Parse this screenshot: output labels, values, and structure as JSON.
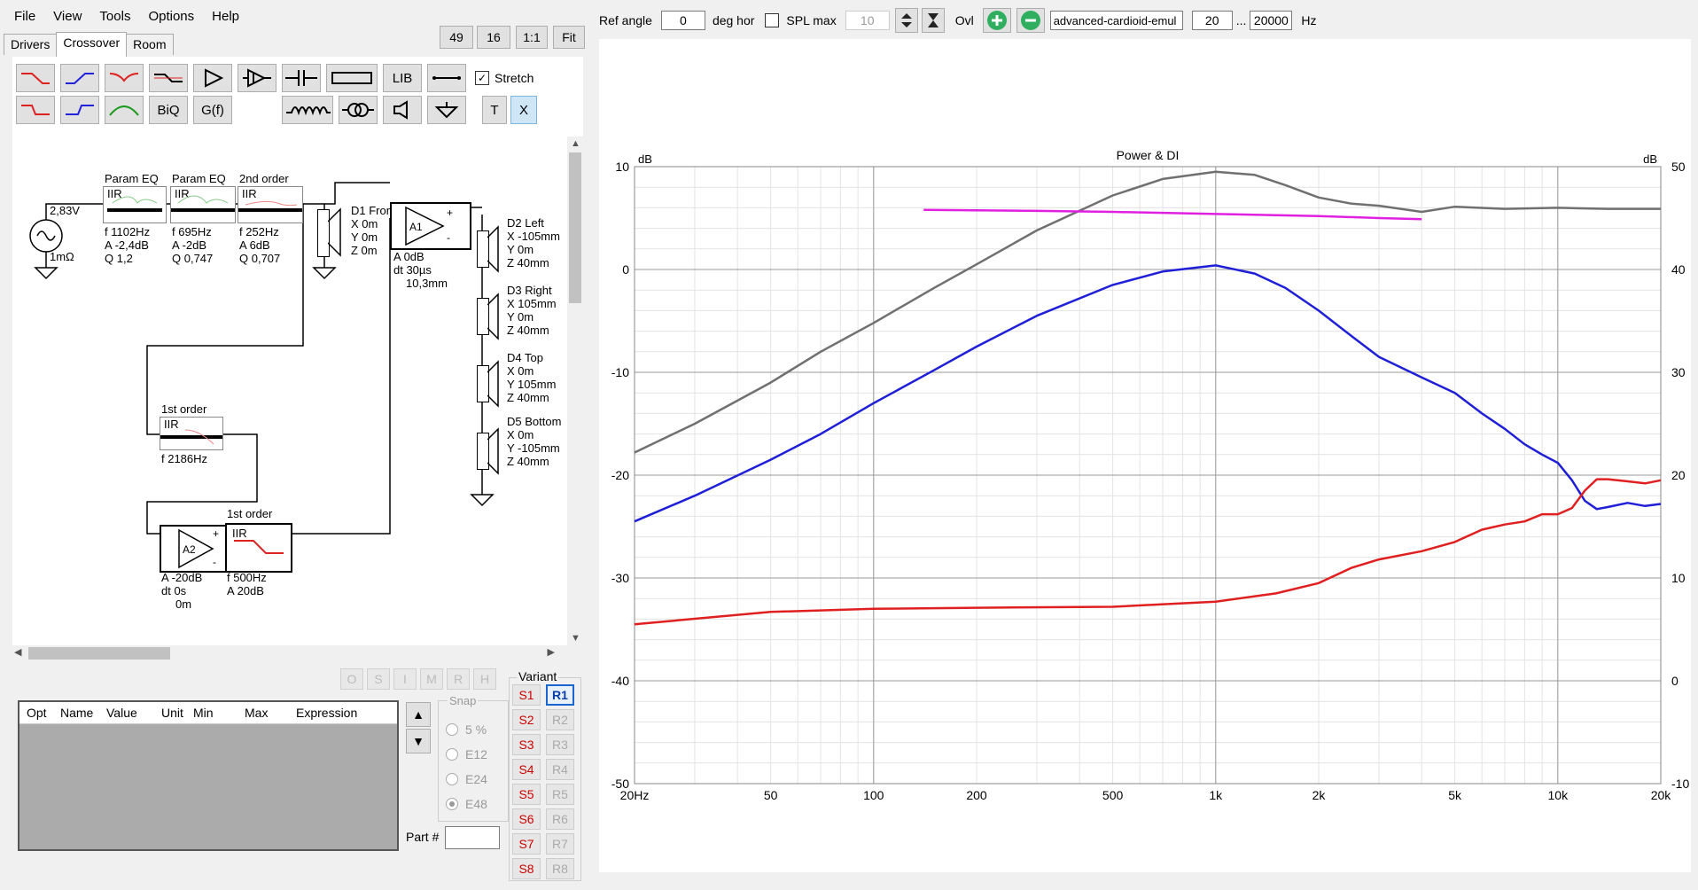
{
  "menu": [
    "File",
    "View",
    "Tools",
    "Options",
    "Help"
  ],
  "tabs": [
    "Drivers",
    "Crossover",
    "Room"
  ],
  "view_buttons": [
    "49",
    "16",
    "1:1",
    "Fit"
  ],
  "toolbar": {
    "lib": "LIB",
    "biq": "BiQ",
    "gf": "G(f)",
    "t": "T",
    "x": "X",
    "stretch": "Stretch"
  },
  "schematic": {
    "source_voltage": "2,83V",
    "source_impedance": "1mΩ",
    "eq1": {
      "title": "Param EQ",
      "type": "IIR",
      "f": "f   1102Hz",
      "a": "A  -2,4dB",
      "q": "Q  1,2"
    },
    "eq2": {
      "title": "Param EQ",
      "type": "IIR",
      "f": "f   695Hz",
      "a": "A  -2dB",
      "q": "Q  0,747"
    },
    "eq3": {
      "title": "2nd order",
      "type": "IIR",
      "f": "f   252Hz",
      "a": "A  6dB",
      "q": "Q  0,707"
    },
    "d1": {
      "name": "D1 Front",
      "x": "X 0m",
      "y": "Y 0m",
      "z": "Z 0m"
    },
    "a1": {
      "name": "A1",
      "gain": "A  0dB",
      "dt": "dt 30µs",
      "dist": "10,3mm"
    },
    "d2": {
      "name": "D2 Left",
      "x": "X -105mm",
      "y": "Y 0m",
      "z": "Z 40mm"
    },
    "d3": {
      "name": "D3 Right",
      "x": "X 105mm",
      "y": "Y 0m",
      "z": "Z 40mm"
    },
    "d4": {
      "name": "D4 Top",
      "x": "X 0m",
      "y": "Y 105mm",
      "z": "Z 40mm"
    },
    "d5": {
      "name": "D5 Bottom",
      "x": "X 0m",
      "y": "Y -105mm",
      "z": "Z 40mm"
    },
    "f1": {
      "title": "1st order",
      "type": "IIR",
      "f": "f   2186Hz"
    },
    "a2": {
      "name": "A2",
      "gain": "A  -20dB",
      "dt": "dt 0s",
      "dist": "0m"
    },
    "f2": {
      "title": "1st order",
      "type": "IIR",
      "f": "f   500Hz",
      "a": "A  20dB"
    }
  },
  "lock_buttons": [
    "O",
    "S",
    "I",
    "M",
    "R",
    "H"
  ],
  "param_table": {
    "columns": [
      "Opt",
      "Name",
      "Value",
      "Unit",
      "Min",
      "Max",
      "Expression"
    ]
  },
  "snap": {
    "title": "Snap",
    "options": [
      "5 %",
      "E12",
      "E24",
      "E48"
    ],
    "selected": "E48"
  },
  "part_label": "Part #",
  "variant": {
    "title": "Variant",
    "s": [
      "S1",
      "S2",
      "S3",
      "S4",
      "S5",
      "S6",
      "S7",
      "S8"
    ],
    "r": [
      "R1",
      "R2",
      "R3",
      "R4",
      "R5",
      "R6",
      "R7",
      "R8"
    ],
    "active_r": "R1"
  },
  "topbar": {
    "ref_angle_label": "Ref angle",
    "ref_angle": "0",
    "deg_label": "deg hor",
    "spl_max_label": "SPL max",
    "spl_max": "10",
    "ovl_label": "Ovl",
    "config_name": "advanced-cardioid-emul",
    "f_min": "20",
    "dots": "...",
    "f_max": "20000",
    "hz": "Hz"
  },
  "colors": {
    "power": "#707070",
    "blue": "#1f1fd8",
    "red": "#e02020",
    "magenta": "#e020e0",
    "add_green": "#2fae5f"
  },
  "chart_data": {
    "type": "line",
    "title": "Power & DI",
    "ylabel": "dB",
    "y2label": "dB",
    "xscale": "log",
    "xlim": [
      20,
      20000
    ],
    "ylim": [
      -50,
      10
    ],
    "y2lim": [
      -10,
      50
    ],
    "x_ticks": [
      {
        "v": 20,
        "label": "20Hz"
      },
      {
        "v": 50,
        "label": "50"
      },
      {
        "v": 100,
        "label": "100"
      },
      {
        "v": 200,
        "label": "200"
      },
      {
        "v": 500,
        "label": "500"
      },
      {
        "v": 1000,
        "label": "1k"
      },
      {
        "v": 2000,
        "label": "2k"
      },
      {
        "v": 5000,
        "label": "5k"
      },
      {
        "v": 10000,
        "label": "10k"
      },
      {
        "v": 20000,
        "label": "20k"
      }
    ],
    "y_ticks": [
      10,
      0,
      -10,
      -20,
      -30,
      -40,
      -50
    ],
    "y2_ticks": [
      50,
      40,
      30,
      20,
      10,
      0,
      -10
    ],
    "grid": true,
    "series": [
      {
        "key": "power",
        "x": [
          20,
          30,
          50,
          70,
          100,
          150,
          200,
          300,
          500,
          700,
          1000,
          1300,
          1600,
          2000,
          2500,
          3000,
          4000,
          5000,
          7000,
          10000,
          14000,
          20000
        ],
        "y": [
          -17.8,
          -15,
          -11,
          -8,
          -5.2,
          -1.8,
          0.5,
          3.8,
          7.2,
          8.8,
          9.5,
          9.2,
          8.2,
          7,
          6.4,
          6.2,
          5.6,
          6.1,
          5.9,
          6.0,
          5.9,
          5.9
        ]
      },
      {
        "key": "blue",
        "x": [
          20,
          30,
          50,
          70,
          100,
          150,
          200,
          300,
          500,
          700,
          1000,
          1300,
          1600,
          2000,
          2500,
          3000,
          4000,
          5000,
          6000,
          7000,
          8000,
          9000,
          10000,
          11000,
          12000,
          13000,
          14000,
          16000,
          18000,
          20000
        ],
        "y": [
          -24.5,
          -22,
          -18.5,
          -16,
          -13,
          -9.8,
          -7.5,
          -4.5,
          -1.5,
          -0.2,
          0.4,
          -0.4,
          -1.8,
          -4,
          -6.5,
          -8.5,
          -10.5,
          -12,
          -14,
          -15.5,
          -17,
          -18,
          -18.8,
          -20.5,
          -22.5,
          -23.3,
          -23.1,
          -22.7,
          -23,
          -22.8
        ]
      },
      {
        "key": "red",
        "x": [
          20,
          50,
          100,
          200,
          500,
          1000,
          1500,
          2000,
          2500,
          3000,
          4000,
          5000,
          6000,
          7000,
          8000,
          9000,
          10000,
          11000,
          12000,
          13000,
          14000,
          16000,
          18000,
          20000
        ],
        "y": [
          -34.5,
          -33.3,
          -33,
          -32.9,
          -32.8,
          -32.3,
          -31.5,
          -30.5,
          -29,
          -28.2,
          -27.4,
          -26.5,
          -25.3,
          -24.8,
          -24.5,
          -23.8,
          -23.8,
          -23.2,
          -21.5,
          -20.4,
          -20.4,
          -20.6,
          -20.8,
          -20.5
        ]
      },
      {
        "key": "magenta",
        "x": [
          140,
          300,
          500,
          1000,
          2000,
          3000,
          4000
        ],
        "y": [
          5.8,
          5.7,
          5.6,
          5.4,
          5.2,
          5.0,
          4.9
        ]
      }
    ]
  }
}
